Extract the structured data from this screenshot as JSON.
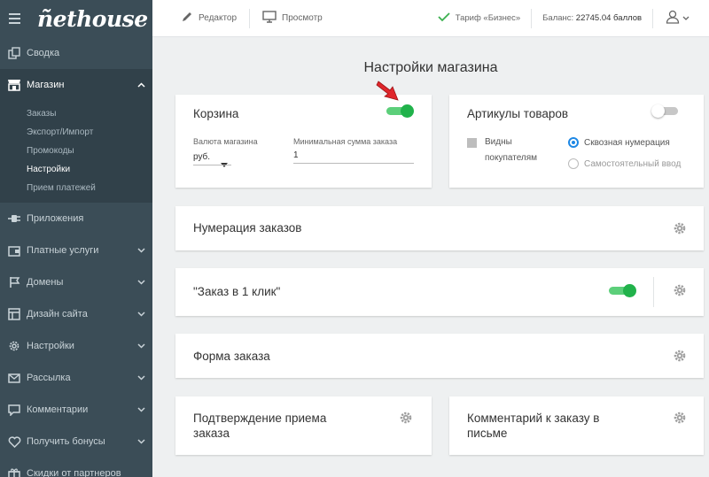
{
  "brand": {
    "logo": "ñethouse"
  },
  "sidebar": {
    "items": [
      {
        "label": "Сводка",
        "icon": "copy-icon",
        "expandable": false
      },
      {
        "label": "Магазин",
        "icon": "store-icon",
        "expandable": true,
        "active": true
      },
      {
        "label": "Приложения",
        "icon": "plug-icon",
        "expandable": false
      },
      {
        "label": "Платные услуги",
        "icon": "wallet-icon",
        "expandable": true
      },
      {
        "label": "Домены",
        "icon": "flag-icon",
        "expandable": true
      },
      {
        "label": "Дизайн сайта",
        "icon": "layout-icon",
        "expandable": true
      },
      {
        "label": "Настройки",
        "icon": "gear-icon",
        "expandable": true
      },
      {
        "label": "Рассылка",
        "icon": "envelope-icon",
        "expandable": true
      },
      {
        "label": "Комментарии",
        "icon": "comment-icon",
        "expandable": true
      },
      {
        "label": "Получить бонусы",
        "icon": "heart-icon",
        "expandable": true
      },
      {
        "label": "Скидки от партнеров",
        "icon": "gift-icon",
        "expandable": false
      }
    ],
    "shop_sub": [
      "Заказы",
      "Экспорт/Импорт",
      "Промокоды",
      "Настройки",
      "Прием платежей"
    ],
    "shop_sub_current": "Настройки"
  },
  "header": {
    "editor": "Редактор",
    "preview": "Просмотр",
    "tariff": "Тариф «Бизнес»",
    "balance_label": "Баланс:",
    "balance_value": "22745.04 баллов"
  },
  "page": {
    "title": "Настройки магазина"
  },
  "cart": {
    "title": "Корзина",
    "enabled": true,
    "currency_label": "Валюта магазина",
    "currency_value": "руб.",
    "min_sum_label": "Минимальная сумма заказа",
    "min_sum_value": "1"
  },
  "sku": {
    "title": "Артикулы товаров",
    "enabled": false,
    "visible_label_1": "Видны",
    "visible_label_2": "покупателям",
    "option_1": "Сквозная нумерация",
    "option_2": "Самостоятельный ввод",
    "selected": "Сквозная нумерация"
  },
  "order_numbering": {
    "title": "Нумерация заказов"
  },
  "one_click": {
    "title": "\"Заказ в 1 клик\"",
    "enabled": true
  },
  "order_form": {
    "title": "Форма заказа"
  },
  "confirm": {
    "title_1": "Подтверждение приема",
    "title_2": "заказа"
  },
  "comment": {
    "title_1": "Комментарий к заказу в",
    "title_2": "письме"
  },
  "colors": {
    "sidebar": "#3b4d57",
    "toggle_on": "#21b24b",
    "radio": "#1e88e5",
    "arrow": "#e0262b",
    "tariff_check": "#3bb04f"
  }
}
